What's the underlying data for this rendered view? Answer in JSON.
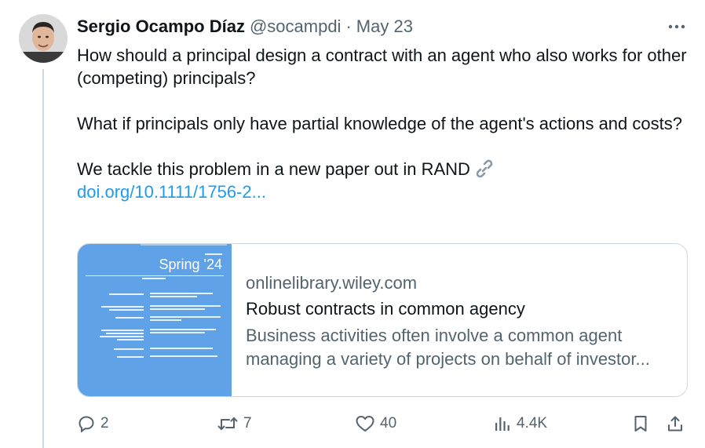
{
  "tweet": {
    "author_name": "Sergio Ocampo Díaz",
    "author_handle": "@socampdi",
    "separator": "·",
    "date": "May 23",
    "text_p1": "How should a principal design a contract with an agent who also works for other (competing) principals?",
    "text_p2": "What if principals only have partial knowledge of the agent's actions and costs?",
    "text_p3": "We tackle this problem in a new paper out in RAND",
    "link_text": "doi.org/10.1111/1756-2...",
    "icons": {
      "more": "more-horizontal-icon",
      "link": "link-icon"
    }
  },
  "card": {
    "thumbnail_season": "Spring '24",
    "domain": "onlinelibrary.wiley.com",
    "title": "Robust contracts in common agency",
    "desc_line1": "Business activities often involve a common agent",
    "desc_line2": "managing a variety of projects on behalf of investor..."
  },
  "actions": {
    "reply_count": "2",
    "retweet_count": "7",
    "like_count": "40",
    "views_count": "4.4K",
    "icons": [
      "reply-icon",
      "retweet-icon",
      "like-icon",
      "views-icon",
      "bookmark-icon",
      "share-icon"
    ]
  },
  "colors": {
    "text_primary": "#0f1419",
    "text_secondary": "#536471",
    "link": "#1d9bf0",
    "border": "#cfd9de",
    "thumbnail_bg": "#5fa2e8"
  }
}
